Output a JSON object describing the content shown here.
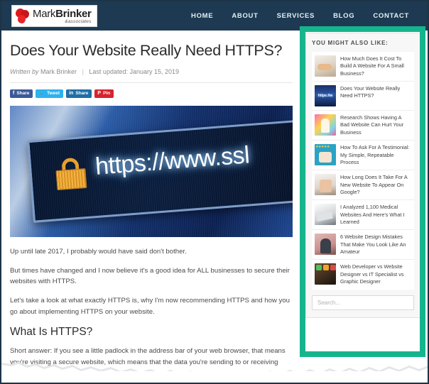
{
  "header": {
    "logo": {
      "name_light": "Mark",
      "name_bold": "Brinker",
      "tagline": "&associates",
      "icon": "red-blob-logo-icon"
    },
    "nav": [
      {
        "label": "HOME",
        "name": "nav-home"
      },
      {
        "label": "ABOUT",
        "name": "nav-about"
      },
      {
        "label": "SERVICES",
        "name": "nav-services"
      },
      {
        "label": "BLOG",
        "name": "nav-blog"
      },
      {
        "label": "CONTACT",
        "name": "nav-contact"
      }
    ]
  },
  "article": {
    "title": "Does Your Website Really Need HTTPS?",
    "meta": {
      "written_by_label": "Written by",
      "author": "Mark Brinker",
      "separator": "|",
      "updated": "Last updated: January 15, 2019"
    },
    "share_buttons": [
      {
        "glyph": "f",
        "label": "Share",
        "network": "facebook"
      },
      {
        "glyph": "🐦",
        "label": "Tweet",
        "network": "twitter"
      },
      {
        "glyph": "in",
        "label": "Share",
        "network": "linkedin"
      },
      {
        "glyph": "P",
        "label": "Pin",
        "network": "pinterest"
      }
    ],
    "hero": {
      "alt": "browser-address-bar-padlock-photo",
      "url_text": "https://www.ssl",
      "lock_icon": "padlock-icon"
    },
    "paragraphs": [
      "Up until late 2017, I probably would have said don't bother.",
      "But times have changed and I now believe it's a good idea for ALL businesses to secure their websites with HTTPS.",
      "Let's take a look at what exactly HTTPS is, why I'm now recommending HTTPS and how you go about implementing HTTPS on your website."
    ],
    "section_heading": "What Is HTTPS?",
    "section_paragraph": "Short answer: If you see a little padlock in the address bar of your web browser, that means you're visiting a secure website, which means that the data you're sending to or receiving"
  },
  "sidebar": {
    "title": "YOU MIGHT ALSO LIKE:",
    "items": [
      {
        "text": "How Much Does It Cost To Build A Website For A Small Business?",
        "thumb": "t1"
      },
      {
        "text": "Does Your Website Really Need HTTPS?",
        "thumb": "t2"
      },
      {
        "text": "Research Shows Having A Bad Website Can Hurt Your Business",
        "thumb": "t3"
      },
      {
        "text": "How To Ask For A Testimonial: My Simple, Repeatable Process",
        "thumb": "t4"
      },
      {
        "text": "How Long Does It Take For A New Website To Appear On Google?",
        "thumb": "t5"
      },
      {
        "text": "I Analyzed 1,100 Medical Websites And Here's What I Learned",
        "thumb": "t6"
      },
      {
        "text": "6 Website Design Mistakes That Make You Look Like An Amateur",
        "thumb": "t7"
      },
      {
        "text": "Web Developer vs Website Designer vs IT Specialist vs Graphic Designer",
        "thumb": "t8"
      }
    ],
    "search": {
      "value": "",
      "placeholder": "Search..."
    }
  },
  "annotation": {
    "highlight_color": "#16b48d",
    "header_color": "#1d3a52"
  }
}
